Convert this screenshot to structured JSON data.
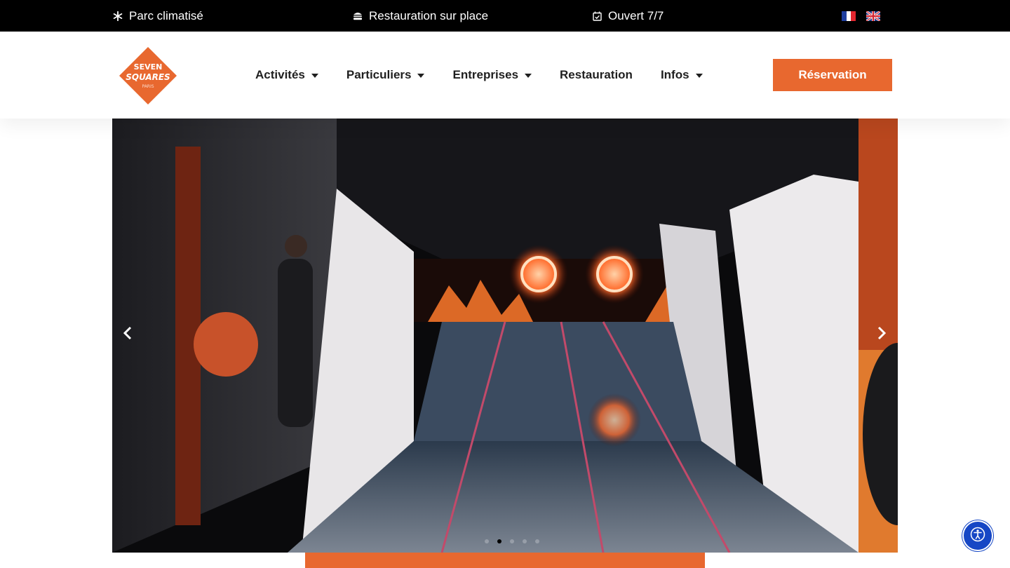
{
  "topbar": {
    "items": [
      {
        "label": "Parc climatisé",
        "icon": "snowflake-icon"
      },
      {
        "label": "Restauration sur place",
        "icon": "burger-icon"
      },
      {
        "label": "Ouvert 7/7",
        "icon": "calendar-check-icon"
      }
    ],
    "languages": [
      {
        "code": "fr",
        "icon": "flag-fr-icon"
      },
      {
        "code": "en",
        "icon": "flag-uk-icon"
      }
    ]
  },
  "header": {
    "logo": {
      "line1": "SEVEN",
      "line2": "SQUARES",
      "line3": "PARIS"
    },
    "nav": [
      {
        "label": "Activités",
        "has_dropdown": true
      },
      {
        "label": "Particuliers",
        "has_dropdown": true
      },
      {
        "label": "Entreprises",
        "has_dropdown": true
      },
      {
        "label": "Restauration",
        "has_dropdown": false
      },
      {
        "label": "Infos",
        "has_dropdown": true
      }
    ],
    "cta_label": "Réservation"
  },
  "slider": {
    "slide_count": 5,
    "active_index": 1,
    "prev_icon": "chevron-left-icon",
    "next_icon": "chevron-right-icon"
  },
  "colors": {
    "accent": "#e8682f",
    "topbar_bg": "#000000",
    "a11y": "#1647c5"
  }
}
